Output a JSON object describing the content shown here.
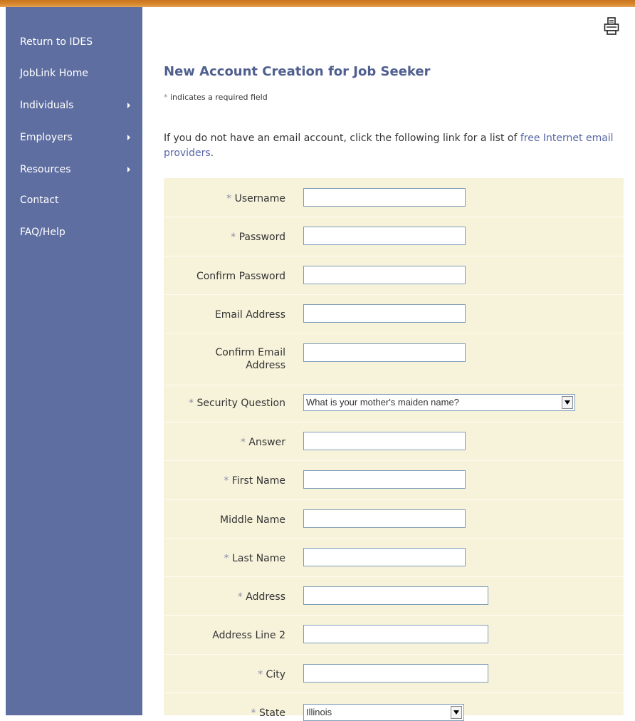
{
  "sidebar": {
    "items": [
      {
        "label": "Return to IDES",
        "has_submenu": false
      },
      {
        "label": "JobLink Home",
        "has_submenu": false
      },
      {
        "label": "Individuals",
        "has_submenu": true
      },
      {
        "label": "Employers",
        "has_submenu": true
      },
      {
        "label": "Resources",
        "has_submenu": true
      },
      {
        "label": "Contact",
        "has_submenu": false
      },
      {
        "label": "FAQ/Help",
        "has_submenu": false
      }
    ]
  },
  "header": {
    "print_icon": "printer-icon",
    "title": "New Account Creation for Job Seeker",
    "required_marker": "*",
    "required_note": "indicates a required field"
  },
  "intro": {
    "text": "If you do not have an email account, click the following link for a list of",
    "link": "free Internet email providers",
    "suffix": "."
  },
  "form": {
    "fields": [
      {
        "label": "Username",
        "required": true,
        "value": ""
      },
      {
        "label": "Password",
        "required": true,
        "value": ""
      },
      {
        "label": "Confirm Password",
        "required": false,
        "value": ""
      },
      {
        "label": "Email Address",
        "required": false,
        "value": ""
      },
      {
        "label": "Confirm Email Address",
        "required": false,
        "value": ""
      },
      {
        "label": "Security Question",
        "required": true,
        "value": "What is your mother's maiden name?"
      },
      {
        "label": "Answer",
        "required": true,
        "value": ""
      },
      {
        "label": "First Name",
        "required": true,
        "value": ""
      },
      {
        "label": "Middle Name",
        "required": false,
        "value": ""
      },
      {
        "label": "Last Name",
        "required": true,
        "value": ""
      },
      {
        "label": "Address",
        "required": true,
        "value": ""
      },
      {
        "label": "Address Line 2",
        "required": false,
        "value": ""
      },
      {
        "label": "City",
        "required": true,
        "value": ""
      },
      {
        "label": "State",
        "required": true,
        "value": "Illinois"
      }
    ]
  },
  "colors": {
    "sidebar_bg": "#5f6ea1",
    "top_bar": "#d9892d",
    "title": "#4f5f8f",
    "link": "#5566a6",
    "form_bg": "#f7f3db"
  }
}
